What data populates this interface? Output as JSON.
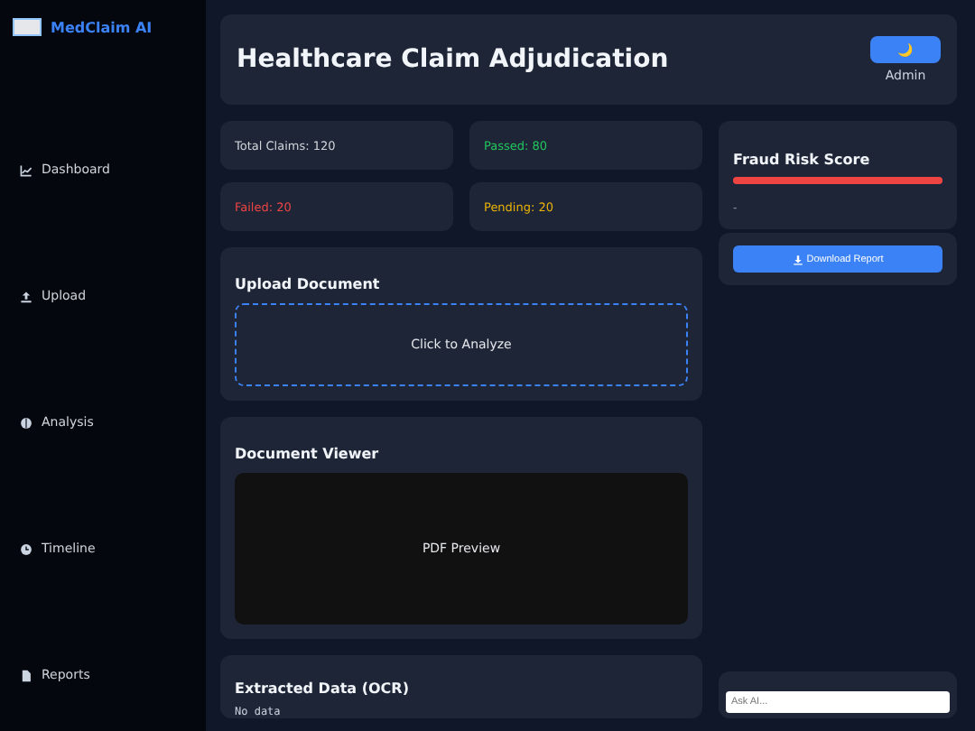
{
  "sidebar": {
    "brand": "MedClaim AI",
    "items": [
      {
        "label": "Dashboard"
      },
      {
        "label": "Upload"
      },
      {
        "label": "Analysis"
      },
      {
        "label": "Timeline"
      },
      {
        "label": "Reports"
      }
    ]
  },
  "header": {
    "title": "Healthcare Claim Adjudication",
    "theme_button": "🌙",
    "user": "Admin"
  },
  "stats": [
    {
      "label": "Total Claims: 120",
      "color": "#d1d5db"
    },
    {
      "label": "Passed: 80",
      "color": "#22c55e"
    },
    {
      "label": "Failed: 20",
      "color": "#ef4444"
    },
    {
      "label": "Pending: 20",
      "color": "#eab308"
    }
  ],
  "fraud": {
    "title": "Fraud Risk Score",
    "level": 1,
    "reading": "-"
  },
  "download_button": "Download Report",
  "upload": {
    "title": "Upload Document",
    "dropzone": "Click to Analyze"
  },
  "viewer": {
    "title": "Document Viewer",
    "preview": "PDF Preview"
  },
  "ocr": {
    "title": "Extracted Data (OCR)",
    "text": "No data"
  },
  "chat": {
    "placeholder": "Ask AI..."
  }
}
